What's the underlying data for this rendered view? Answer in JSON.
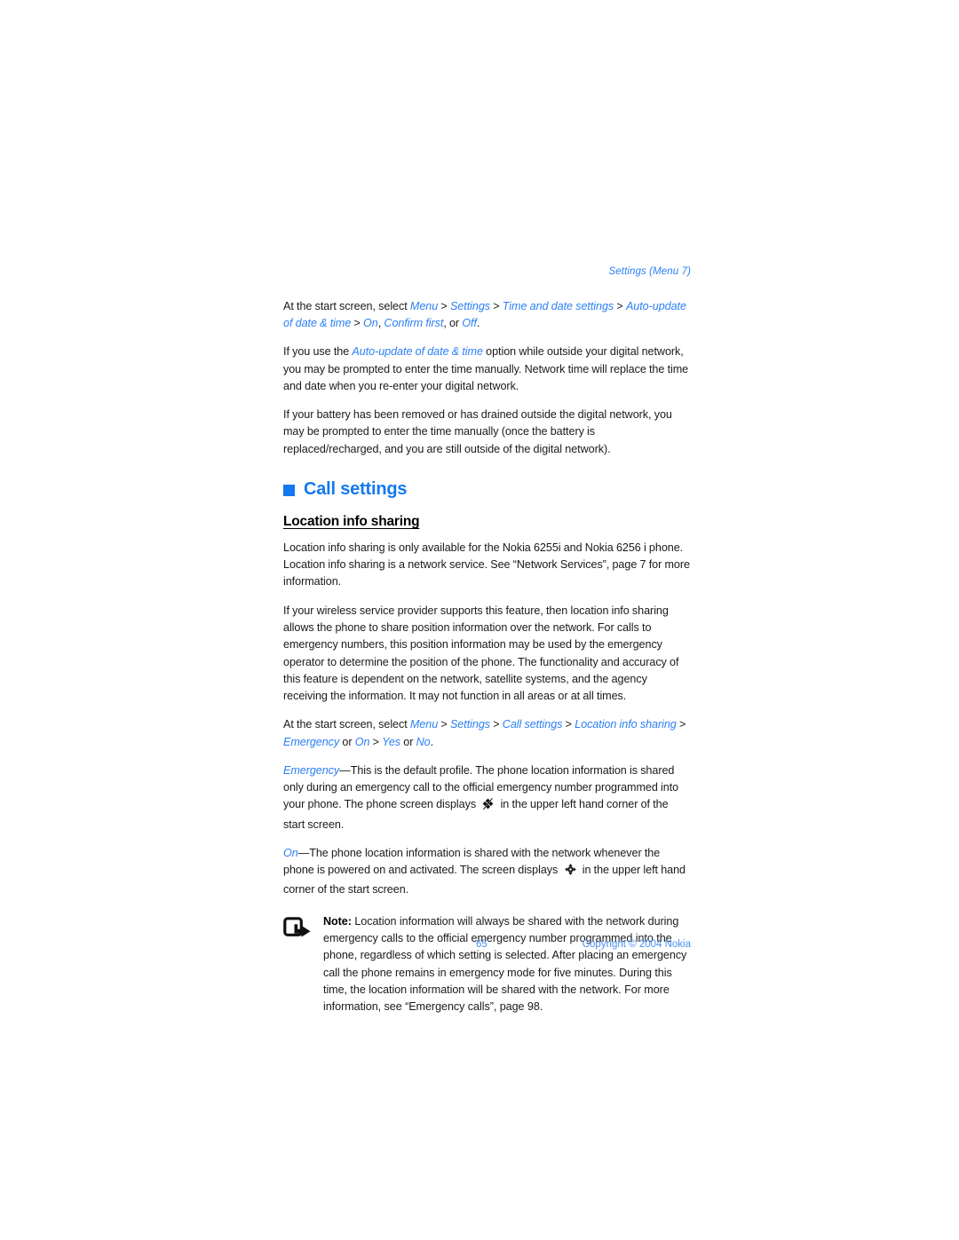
{
  "document": {
    "running_head": "Settings (Menu 7)",
    "page_number": "65",
    "copyright": "Copyright © 2004 Nokia"
  },
  "colors": {
    "accent_blue": "#1479f0",
    "nav_blue": "#2b7ff5",
    "footer_blue": "#4a90f0",
    "body_text": "#1a1a1a"
  },
  "intro": {
    "para1": {
      "lead": "At the start screen, select ",
      "nav1": "Menu",
      "nav2": "Settings",
      "nav3": "Time and date settings",
      "nav4": "Auto-update of date & time",
      "nav5": "On",
      "nav6": "Confirm first",
      "nav7": "Off",
      "mid_or": ", or ",
      "comma": ", ",
      "end": "."
    },
    "para2_a": "If you use the ",
    "para2_nav": "Auto-update of date & time",
    "para2_b": " option while outside your digital network, you may be prompted to enter the time manually. Network time will replace the time and date when you re-enter your digital network.",
    "para3": "If your battery has been removed or has drained outside the digital network, you may be prompted to enter the time manually (once the battery is replaced/recharged, and you are still outside of the digital network)."
  },
  "chapter": {
    "title": "Call settings"
  },
  "section": {
    "title": "Location info sharing",
    "para1": "Location info sharing is only available for the Nokia 6255i and Nokia 6256 i phone. Location info sharing is a network service. See “Network Services”, page 7 for more information.",
    "para2": "If your wireless service provider supports this feature, then location info sharing allows the phone to share position information over the network. For calls to emergency numbers, this position information may be used by the emergency operator to determine the position of the phone. The functionality and accuracy of this feature is dependent on the network, satellite systems, and the agency receiving the information. It may not function in all areas or at all times.",
    "path": {
      "lead": "At the start screen, select ",
      "nav1": "Menu",
      "nav2": "Settings",
      "nav3": "Call settings",
      "nav4": "Location info sharing",
      "nav5": "Emergency",
      "or1": " or ",
      "nav6": "On",
      "nav7": "Yes",
      "or2": " or ",
      "nav8": "No",
      "end": "."
    },
    "emergency": {
      "term": "Emergency",
      "text_a": "—This is the default profile. The phone location information is shared only during an emergency call to the official emergency number programmed into your phone. The phone screen displays ",
      "icon": "location-sharing-off-icon",
      "text_b": " in the upper left hand corner of the start screen."
    },
    "on": {
      "term": "On",
      "text_a": "—The phone location information is shared with the network whenever the phone is powered on and activated. The screen displays ",
      "icon": "location-sharing-on-icon",
      "text_b": " in the upper left hand corner of the start screen."
    }
  },
  "note": {
    "icon": "note-arrow-icon",
    "label": "Note:",
    "text": " Location information will always be shared with the network during emergency calls to the official emergency number programmed into the phone, regardless of which setting is selected. After placing an emergency call the phone remains in emergency mode for five minutes. During this time, the location information will be shared with the network. For more information, see “Emergency calls”, page 98."
  }
}
